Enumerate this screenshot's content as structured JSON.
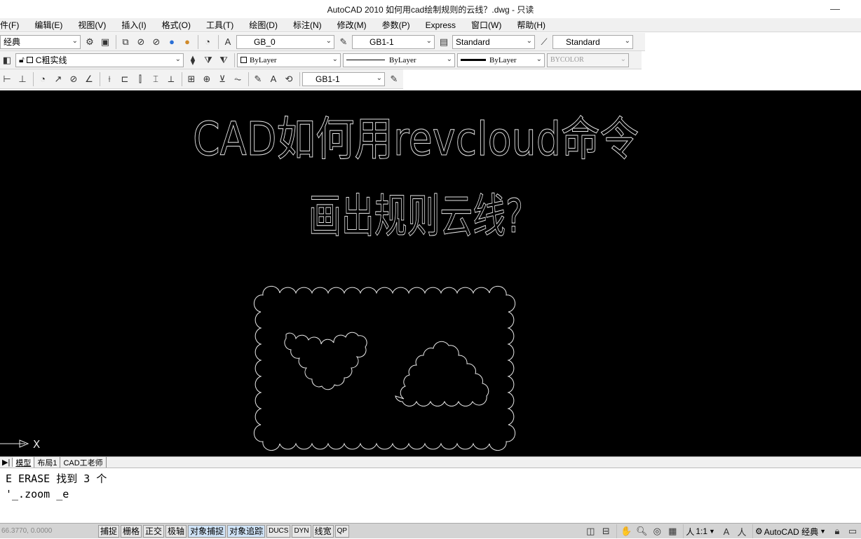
{
  "window": {
    "title": "AutoCAD 2010      如何用cad绘制规则的云线？.dwg - 只读",
    "minimize": "—"
  },
  "menu": [
    "件(F)",
    "编辑(E)",
    "视图(V)",
    "插入(I)",
    "格式(O)",
    "工具(T)",
    "绘图(D)",
    "标注(N)",
    "修改(M)",
    "参数(P)",
    "Express",
    "窗口(W)",
    "帮助(H)"
  ],
  "toolbar1": {
    "workspace": "经典",
    "text_style": "GB_0",
    "dim_style": "GB1-1",
    "table_style": "Standard",
    "multileader_style": "Standard"
  },
  "toolbar2": {
    "layer": "C粗实线",
    "color": "ByLayer",
    "linetype": "ByLayer",
    "lineweight": "ByLayer",
    "plotstyle": "BYCOLOR"
  },
  "toolbar3": {
    "dim_style": "GB1-1"
  },
  "drawing": {
    "title_line1": "CAD如何用revcloud命令",
    "title_line2": "画出规则云线?",
    "ucs_x": "X"
  },
  "tabs": [
    "模型",
    "布局1",
    "CAD工老师"
  ],
  "command_lines": [
    "E ERASE 找到 3 个",
    "'_.zoom _e"
  ],
  "status": {
    "coords": "66.3770, 0.0000",
    "buttons": [
      "捕捉",
      "栅格",
      "正交",
      "极轴",
      "对象捕捉",
      "对象追踪",
      "DUCS",
      "DYN",
      "线宽",
      "QP"
    ],
    "on_buttons": [
      "对象捕捉",
      "对象追踪"
    ],
    "scale": "1:1",
    "workspace": "AutoCAD 经典"
  }
}
